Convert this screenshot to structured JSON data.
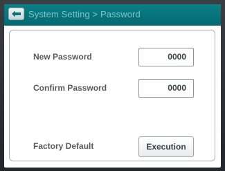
{
  "header": {
    "title": "System Setting > Password",
    "back_icon": "back-arrow-icon"
  },
  "form": {
    "new_password_label": "New Password",
    "new_password_value": "0000",
    "confirm_password_label": "Confirm Password",
    "confirm_password_value": "0000",
    "factory_default_label": "Factory Default",
    "execution_label": "Execution"
  },
  "colors": {
    "titlebar": "#0a767d",
    "title_text": "#7fc4c9",
    "label_text": "#555a60"
  }
}
